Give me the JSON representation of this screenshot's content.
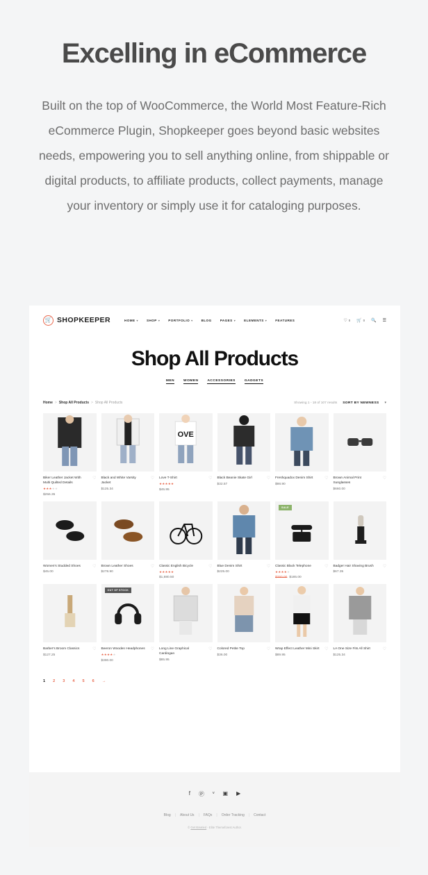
{
  "promo": {
    "heading": "Excelling in eCommerce",
    "body": "Built on the top of WooCommerce, the World Most Feature-Rich eCommerce Plugin, Shopkeeper goes beyond basic websites needs, empowering you to sell anything online, from shippable or digital products, to affiliate products, collect payments, manage your inventory or simply use it for cataloging purposes."
  },
  "site": {
    "logo_text": "SHOPKEEPER",
    "logo_icon": "cart-icon",
    "nav": [
      {
        "label": "HOME",
        "has_dropdown": true
      },
      {
        "label": "SHOP",
        "has_dropdown": true
      },
      {
        "label": "PORTFOLIO",
        "has_dropdown": true
      },
      {
        "label": "BLOG",
        "has_dropdown": false
      },
      {
        "label": "PAGES",
        "has_dropdown": true
      },
      {
        "label": "ELEMENTS",
        "has_dropdown": true
      },
      {
        "label": "FEATURES",
        "has_dropdown": false
      }
    ],
    "header_icons": {
      "wishlist_icon": "heart-icon",
      "wishlist_count": "0",
      "cart_icon": "cart-icon",
      "cart_count": "0",
      "search_icon": "search-icon",
      "menu_icon": "hamburger-icon"
    },
    "page_title": "Shop All Products",
    "categories": [
      "MEN",
      "WOMEN",
      "ACCESSORIES",
      "GADGETS"
    ],
    "breadcrumb": {
      "home": "Home",
      "parent": "Shop All Products",
      "current": "Shop All Products",
      "separator": ">"
    },
    "showing": "Showing 1 - 18 of 107 results",
    "sort_label": "SORT BY NEWNESS",
    "pagination": {
      "pages": [
        "1",
        "2",
        "3",
        "4",
        "5",
        "6"
      ],
      "active": "1",
      "next": "→"
    },
    "footer": {
      "social": [
        "facebook-icon",
        "pinterest-icon",
        "twitter-icon",
        "instagram-icon",
        "youtube-icon"
      ],
      "social_glyphs": [
        "f",
        "Ⓟ",
        "ᵛ",
        "▣",
        "▶"
      ],
      "links": [
        "Blog",
        "About Us",
        "FAQs",
        "Order Tracking",
        "Contact"
      ],
      "copyright_prefix": "© ",
      "copyright_link": "Get Bowtied",
      "copyright_suffix": " - Elite Themeforest Author."
    },
    "colors": {
      "accent": "#e8674c",
      "sale_badge": "#8cb36a",
      "oos_badge": "#555555",
      "text": "#2f2f2f"
    }
  },
  "products": [
    {
      "name": "Biker Leather Jacket With Multi Quilted Details",
      "price": "$256.35",
      "rating": 3,
      "badge": null,
      "art": "jacket"
    },
    {
      "name": "Black and White Varsity Jacket",
      "price": "$125.34",
      "rating": 0,
      "badge": null,
      "art": "varsity"
    },
    {
      "name": "Love T-Shirt",
      "price": "$45.95",
      "rating": 5,
      "badge": null,
      "art": "tshirt"
    },
    {
      "name": "Black Beanie Skate Girl",
      "price": "$32.57",
      "rating": 0,
      "badge": null,
      "art": "beanie"
    },
    {
      "name": "Freshquadox Denim Shirt",
      "price": "$98.90",
      "rating": 0,
      "badge": null,
      "art": "denimman"
    },
    {
      "name": "Brown Animal Print Sunglasses",
      "price": "$660.00",
      "rating": 0,
      "badge": null,
      "art": "sunglasses"
    },
    {
      "name": "Women's Studded Shoes",
      "price": "$45.00",
      "rating": 0,
      "badge": null,
      "art": "studdedshoes"
    },
    {
      "name": "Brown Leather Shoes",
      "price": "$278.90",
      "rating": 0,
      "badge": null,
      "art": "leathershoes"
    },
    {
      "name": "Classic English Bicycle",
      "price": "$1,880.50",
      "rating": 5,
      "badge": null,
      "art": "bicycle"
    },
    {
      "name": "Blue Denim Shirt",
      "price": "$225.00",
      "rating": 0,
      "badge": null,
      "art": "blueshirt"
    },
    {
      "name": "Classic Black Telephone",
      "price": "$185.00",
      "old_price": "$250.00",
      "rating": 4,
      "badge": "SALE",
      "art": "telephone"
    },
    {
      "name": "Badger Hair Shaving Brush",
      "price": "$67.35",
      "rating": 0,
      "badge": null,
      "art": "shavingbrush"
    },
    {
      "name": "Barber's Broom Classics",
      "price": "$127.25",
      "rating": 0,
      "badge": null,
      "art": "broom"
    },
    {
      "name": "Beeron Wooden Headphones",
      "price": "$390.00",
      "rating": 4,
      "badge": "OUT OF STOCK",
      "art": "headphones"
    },
    {
      "name": "Long Line Graphical Cardingan",
      "price": "$85.95",
      "rating": 0,
      "badge": null,
      "art": "cardigan"
    },
    {
      "name": "Colored Petite Top",
      "price": "$36.00",
      "rating": 0,
      "badge": null,
      "art": "petitetop"
    },
    {
      "name": "Wrap Effect Leather Mini Skirt",
      "price": "$89.95",
      "rating": 0,
      "badge": null,
      "art": "miniskirt"
    },
    {
      "name": "LA One Size Fits All Shirt",
      "price": "$125.34",
      "rating": 0,
      "badge": null,
      "art": "lashirt"
    }
  ]
}
